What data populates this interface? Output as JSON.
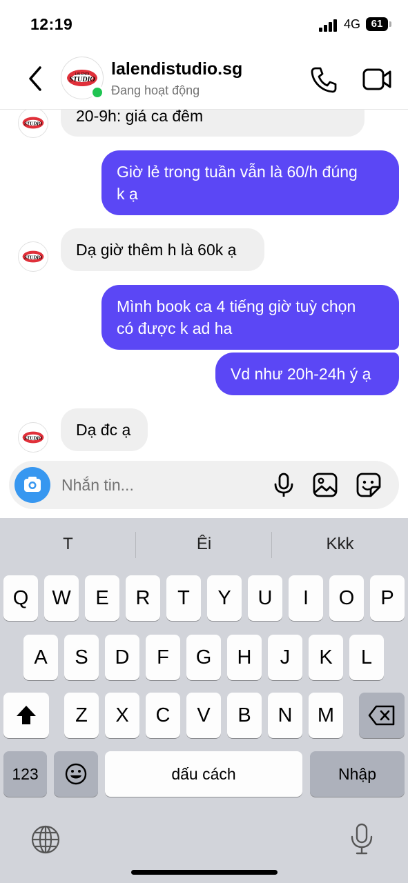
{
  "status_bar": {
    "time": "12:19",
    "network": "4G",
    "battery": "61"
  },
  "header": {
    "contact_name": "lalendistudio.sg",
    "presence": "Đang hoạt động",
    "avatar_logo_text": "STUDIO",
    "avatar_logo_small": "LALENDI",
    "colors": {
      "online": "#1fc452",
      "logo_red": "#e0303a"
    }
  },
  "messages": [
    {
      "from": "them",
      "text": "20-9h: giá ca đêm"
    },
    {
      "from": "me",
      "lines": [
        "Giờ lẻ trong tuần vẫn là 60/h đúng",
        "k ạ"
      ]
    },
    {
      "from": "them",
      "text": "Dạ giờ thêm h là 60k ạ"
    },
    {
      "from": "me",
      "lines": [
        "Mình book ca 4 tiếng giờ tuỳ chọn",
        "có được k ad ha"
      ]
    },
    {
      "from": "me",
      "text": "Vd như 20h-24h ý ạ"
    },
    {
      "from": "them",
      "text": "Dạ đc ạ"
    }
  ],
  "bubble_colors": {
    "outgoing": "#5b47f5",
    "incoming": "#efefef"
  },
  "composer": {
    "placeholder": "Nhắn tin...",
    "icons": [
      "camera-icon",
      "microphone-icon",
      "gallery-icon",
      "sticker-icon"
    ],
    "camera_color": "#3797f0"
  },
  "keyboard": {
    "suggestions": [
      "T",
      "Êi",
      "Kkk"
    ],
    "row1": [
      "Q",
      "W",
      "E",
      "R",
      "T",
      "Y",
      "U",
      "I",
      "O",
      "P"
    ],
    "row2": [
      "A",
      "S",
      "D",
      "F",
      "G",
      "H",
      "J",
      "K",
      "L"
    ],
    "row3": [
      "Z",
      "X",
      "C",
      "V",
      "B",
      "N",
      "M"
    ],
    "numbers_label": "123",
    "space_label": "dấu cách",
    "return_label": "Nhập",
    "icons": [
      "shift-icon",
      "backspace-icon",
      "emoji-icon",
      "globe-icon",
      "dictation-icon"
    ]
  }
}
